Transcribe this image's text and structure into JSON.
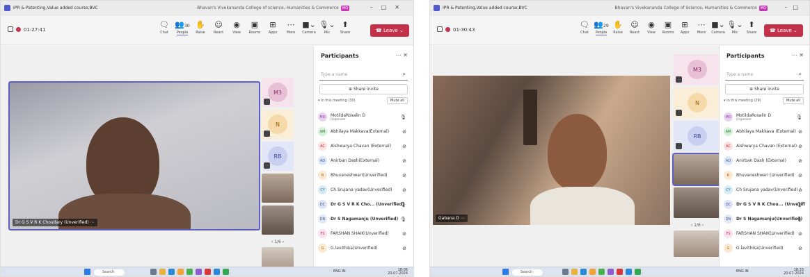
{
  "left": {
    "title": "IPR & Patenting,Value added course,BVC",
    "org": "Bhavan's Vivekananda College of science, Humanities & Commerce",
    "org_badge": "MO",
    "timer": "01:27:41",
    "toolbar": [
      "Chat",
      "People",
      "Raise",
      "React",
      "View",
      "Rooms",
      "Apps",
      "More",
      "Camera",
      "Mic",
      "Share"
    ],
    "people_count": "30",
    "leave_label": "Leave",
    "main_name": "Dr G S V R K Choudary (Unverified)",
    "tiles": [
      "M3",
      "N",
      "RB"
    ],
    "pager": "1/6",
    "panel_title": "Participants",
    "search_placeholder": "Type a name",
    "share_invite": "Share invite",
    "section": "In this meeting (30)",
    "mute_all": "Mute all",
    "participants": [
      {
        "init": "MD",
        "name": "MotildaRosalin D",
        "sub": "Organizer",
        "color": "#e8d3f0",
        "fg": "#8a3aa8"
      },
      {
        "init": "AM",
        "name": "Abhilaya Makkava(External)",
        "sub": "",
        "color": "#d5efd8",
        "fg": "#2e7d32"
      },
      {
        "init": "AC",
        "name": "Aishwarya Chavan (External)",
        "sub": "",
        "color": "#fde0e0",
        "fg": "#c62828"
      },
      {
        "init": "AD",
        "name": "Anirban Dash(External)",
        "sub": "",
        "color": "#dde7f7",
        "fg": "#34568b"
      },
      {
        "init": "B",
        "name": "Bhuvaneshwari(Unverified)",
        "sub": "",
        "color": "#fbe9d4",
        "fg": "#b35c00"
      },
      {
        "init": "CY",
        "name": "Ch Srujana yadav(Unverified)",
        "sub": "",
        "color": "#d8ecf7",
        "fg": "#2a6b8e"
      },
      {
        "init": "DC",
        "name": "Dr G S V R K Cho... (Unverified)",
        "sub": "",
        "color": "#e0e4f5",
        "fg": "#3b4a9e"
      },
      {
        "init": "DN",
        "name": "Dr S Nagamanju (Unverified)",
        "sub": "",
        "color": "#e2e9f5",
        "fg": "#3d5a8f"
      },
      {
        "init": "FS",
        "name": "FARSHAN SHAIK(Unverified)",
        "sub": "",
        "color": "#fde0ec",
        "fg": "#b0306a"
      },
      {
        "init": "G",
        "name": "G.lavithika(Unverified)",
        "sub": "",
        "color": "#fbe9d4",
        "fg": "#b35c00"
      }
    ],
    "taskbar": {
      "search": "Search",
      "lang": "ENG\nIN",
      "time": "18:06",
      "date": "20-07-2024"
    }
  },
  "right": {
    "title": "IPR & Patenting,Value added course,BVC",
    "org": "Bhavan's Vivekananda College of Science, Humanities & Commerce",
    "org_badge": "MO",
    "timer": "01:30:43",
    "toolbar": [
      "Chat",
      "People",
      "Raise",
      "React",
      "View",
      "Rooms",
      "Apps",
      "More",
      "Camera",
      "Mic",
      "Share"
    ],
    "people_count": "29",
    "leave_label": "Leave",
    "main_name": "Gabana D",
    "tiles": [
      "M3",
      "N",
      "RB"
    ],
    "pager": "1/6",
    "panel_title": "Participants",
    "search_placeholder": "Type a name",
    "share_invite": "Share invite",
    "section": "In this meeting (29)",
    "mute_all": "Mute all",
    "participants": [
      {
        "init": "MD",
        "name": "MotildaRosalin D",
        "sub": "Organizer",
        "color": "#e8d3f0",
        "fg": "#8a3aa8"
      },
      {
        "init": "AM",
        "name": "Abhilaya Makkava (External)",
        "sub": "",
        "color": "#d5efd8",
        "fg": "#2e7d32"
      },
      {
        "init": "AC",
        "name": "Aishwarya Chavan (External)",
        "sub": "",
        "color": "#fde0e0",
        "fg": "#c62828"
      },
      {
        "init": "AD",
        "name": "Anirban Dash (External)",
        "sub": "",
        "color": "#dde7f7",
        "fg": "#34568b"
      },
      {
        "init": "B",
        "name": "Bhuvaneshwari (Unverified)",
        "sub": "",
        "color": "#fbe9d4",
        "fg": "#b35c00"
      },
      {
        "init": "CY",
        "name": "Ch Srujana yadav(Unverified)",
        "sub": "",
        "color": "#d8ecf7",
        "fg": "#2a6b8e"
      },
      {
        "init": "DC",
        "name": "Dr G S V R K Chou... (Unverified)",
        "sub": "",
        "color": "#e0e4f5",
        "fg": "#3b4a9e"
      },
      {
        "init": "DN",
        "name": "Dr S Nagamanju(Unverified)",
        "sub": "",
        "color": "#e2e9f5",
        "fg": "#3d5a8f"
      },
      {
        "init": "FS",
        "name": "FARSHAN SHAIK(Unverified)",
        "sub": "",
        "color": "#fde0ec",
        "fg": "#b0306a"
      },
      {
        "init": "G",
        "name": "G.lavithika(Unverified)",
        "sub": "",
        "color": "#fbe9d4",
        "fg": "#b35c00"
      }
    ],
    "taskbar": {
      "search": "Search",
      "lang": "ENG\nIN",
      "time": "18:33",
      "date": "20-07-2024"
    }
  }
}
